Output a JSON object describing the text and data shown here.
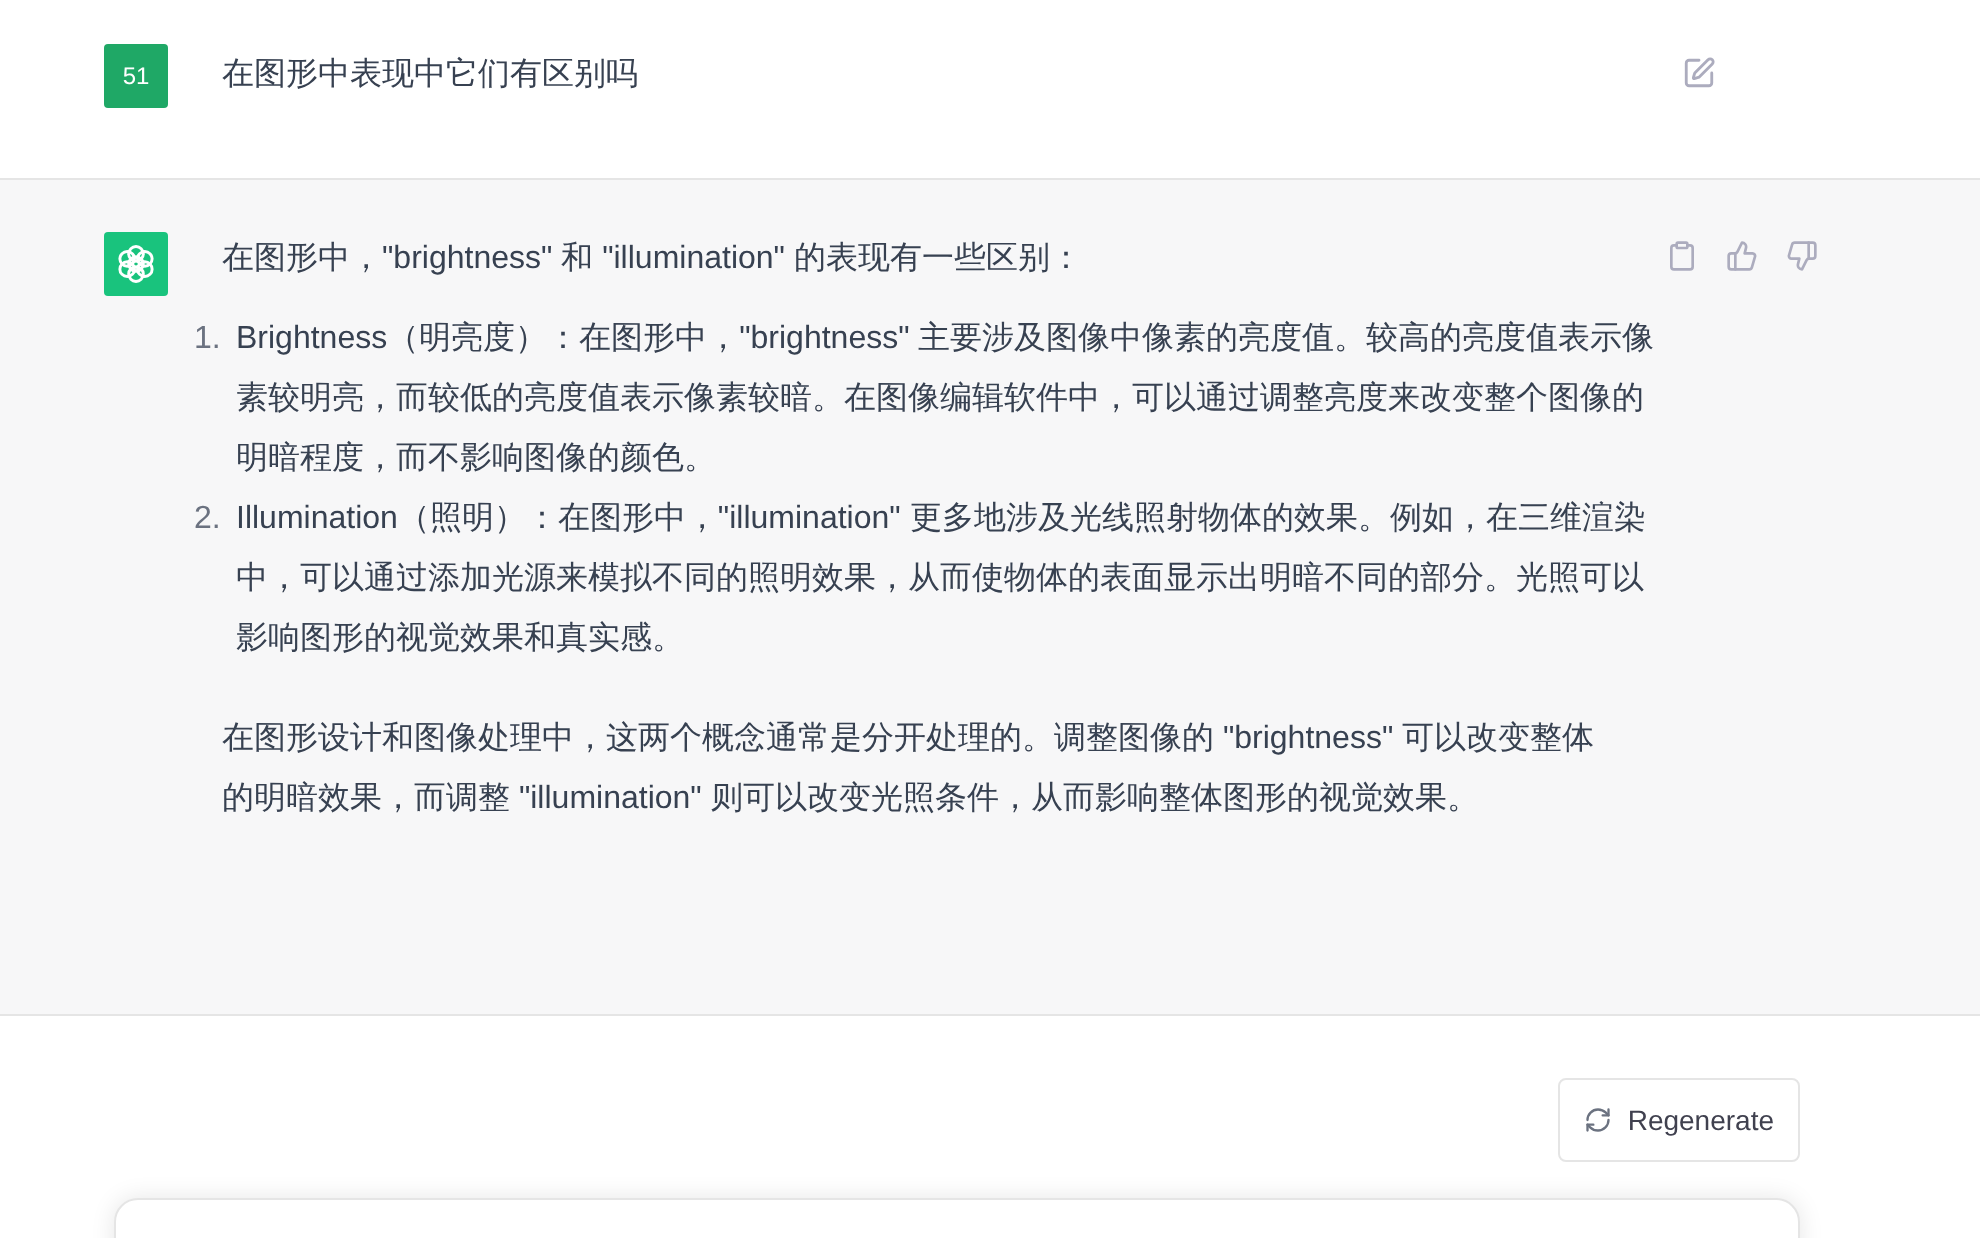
{
  "user_message": {
    "avatar": "51",
    "text": "在图形中表现中它们有区别吗"
  },
  "assistant_message": {
    "intro": "在图形中，\"brightness\" 和 \"illumination\" 的表现有一些区别：",
    "list": [
      {
        "number": "1.",
        "text": "Brightness（明亮度）：在图形中，\"brightness\" 主要涉及图像中像素的亮度值。较高的亮度值表示像素较明亮，而较低的亮度值表示像素较暗。在图像编辑软件中，可以通过调整亮度来改变整个图像的明暗程度，而不影响图像的颜色。"
      },
      {
        "number": "2.",
        "text": "Illumination（照明）：在图形中，\"illumination\" 更多地涉及光线照射物体的效果。例如，在三维渲染中，可以通过添加光源来模拟不同的照明效果，从而使物体的表面显示出明暗不同的部分。光照可以影响图形的视觉效果和真实感。"
      }
    ],
    "conclusion": "在图形设计和图像处理中，这两个概念通常是分开处理的。调整图像的 \"brightness\" 可以改变整体的明暗效果，而调整 \"illumination\" 则可以改变光照条件，从而影响整体图形的视觉效果。"
  },
  "regenerate_button": "Regenerate"
}
